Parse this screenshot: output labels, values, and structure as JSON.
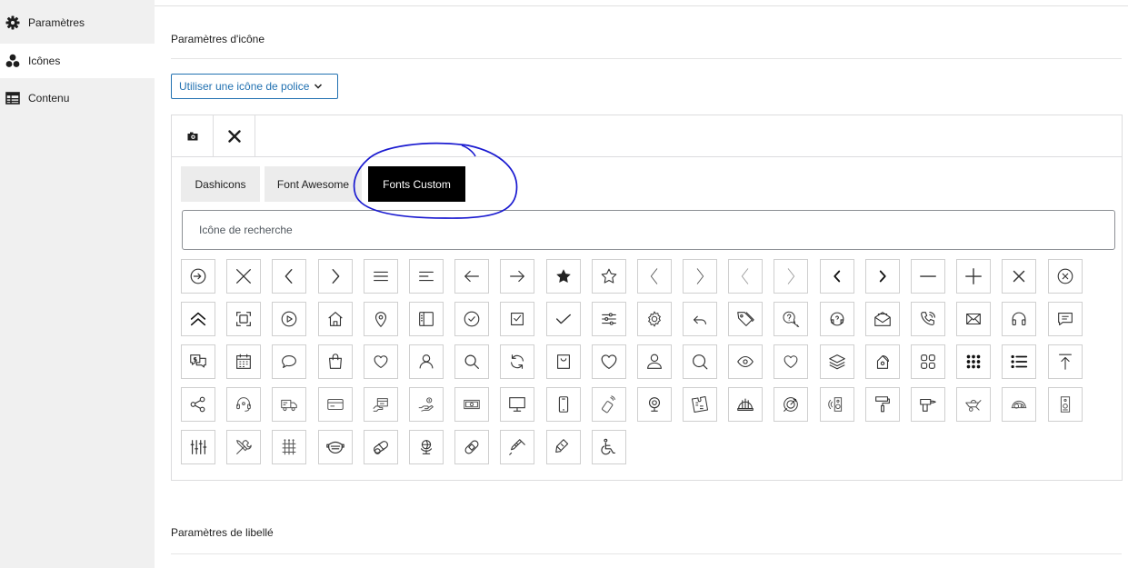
{
  "sidebar": {
    "items": [
      {
        "label": "Paramètres",
        "icon": "gear-icon",
        "active": false
      },
      {
        "label": "Icônes",
        "icon": "icons-icon",
        "active": true
      },
      {
        "label": "Contenu",
        "icon": "table-icon",
        "active": false
      }
    ]
  },
  "main": {
    "icon_settings_title": "Paramètres d'icône",
    "icon_type_select": "Utiliser une icône de police",
    "label_settings_title": "Paramètres de libellé"
  },
  "panel": {
    "toolbar": [
      {
        "icon": "camera-icon"
      },
      {
        "icon": "close-icon"
      }
    ],
    "tabs": [
      {
        "label": "Dashicons",
        "active": false
      },
      {
        "label": "Font Awesome",
        "active": false
      },
      {
        "label": "Fonts Custom",
        "active": true
      }
    ],
    "search_placeholder": "Icône de recherche",
    "icons": [
      "enter-circle-icon",
      "x-icon",
      "chevron-left-icon",
      "chevron-right-icon",
      "menu-icon",
      "align-left-icon",
      "arrow-left-icon",
      "arrow-right-icon",
      "star-filled-icon",
      "star-outline-icon",
      "chevron-left-thin-icon",
      "chevron-right-thin-icon",
      "chevron-left-light-icon",
      "chevron-right-light-icon",
      "chevron-left-bold-icon",
      "chevron-right-bold-icon",
      "minus-icon",
      "plus-icon",
      "close-icon",
      "close-circle-icon",
      "double-chevron-up-icon",
      "focus-frame-icon",
      "play-circle-icon",
      "home-icon",
      "location-pin-icon",
      "sidebar-layout-icon",
      "check-circle-icon",
      "check-square-icon",
      "check-icon",
      "sliders-icon",
      "settings-icon",
      "reply-icon",
      "tags-icon",
      "help-chat-icon",
      "support-icon",
      "mail-open-icon",
      "phone-call-icon",
      "envelope-icon",
      "headphones-icon",
      "chat-bubble-icon",
      "money-chat-icon",
      "calendar-icon",
      "speech-bubble-icon",
      "shopping-bag-icon",
      "heart-icon",
      "user-icon",
      "search-icon",
      "refresh-icon",
      "bag-icon",
      "heart-outline-icon",
      "user-outline-icon",
      "magnifier-icon",
      "eye-icon",
      "heart-thin-icon",
      "layers-icon",
      "home-badge-icon",
      "grid-icon",
      "dots-grid-icon",
      "list-icon",
      "upload-top-icon",
      "share-icon",
      "headset-icon",
      "delivery-truck-icon",
      "credit-card-icon",
      "payment-card-icon",
      "hand-money-icon",
      "cash-icon",
      "monitor-icon",
      "smartphone-icon",
      "vibration-icon",
      "webcam-icon",
      "puzzle-icon",
      "helmet-icon",
      "target-icon",
      "speaker-icon",
      "paint-roller-icon",
      "drill-icon",
      "wheelbarrow-icon",
      "cement-mixer-icon",
      "electric-panel-icon",
      "equalizer-icon",
      "tools-icon",
      "fence-icon",
      "face-mask-icon",
      "pills-icon",
      "globe-stand-icon",
      "bandage-icon",
      "syringe-icon",
      "lipstick-icon",
      "wheelchair-icon"
    ]
  },
  "colors": {
    "accent": "#2271b1",
    "annotation": "#1a1ad0",
    "active_tab": "#000000",
    "sidebar_bg": "#f0f0f0"
  }
}
